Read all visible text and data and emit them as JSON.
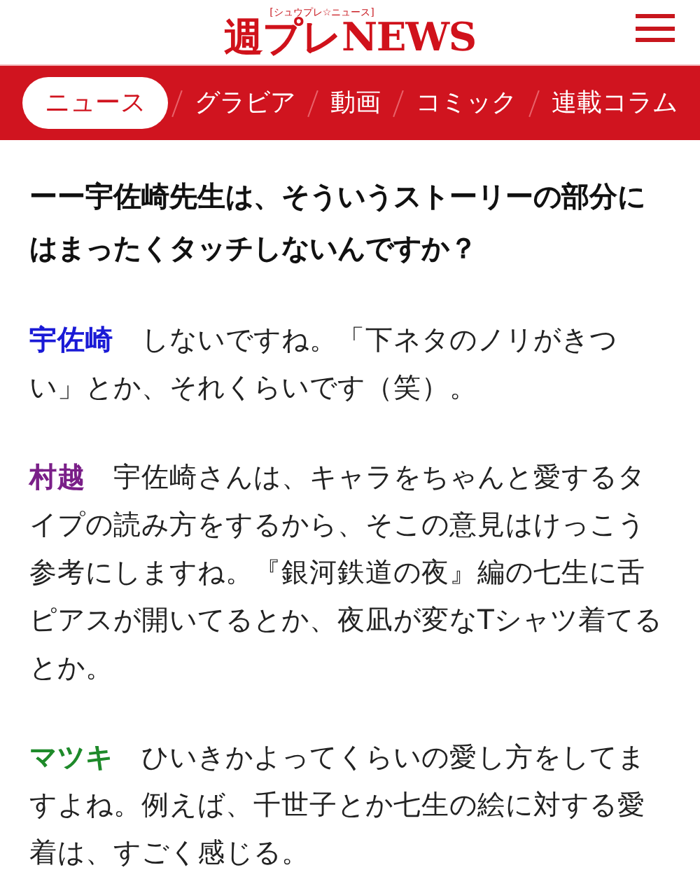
{
  "header": {
    "logo_caption": "[シュウプレ☆ニュース]",
    "logo": "週プレNEWS"
  },
  "nav": [
    {
      "label": "ニュース",
      "selected": true
    },
    {
      "label": "グラビア",
      "selected": false
    },
    {
      "label": "動画",
      "selected": false
    },
    {
      "label": "コミック",
      "selected": false
    },
    {
      "label": "連載コラム",
      "selected": false
    }
  ],
  "question": "ーー宇佐崎先生は、そういうストーリーの部分にはまったくタッチしないんですか？",
  "answers": [
    {
      "speaker": "宇佐崎",
      "color": "#1a1ad6",
      "text": "しないですね。「下ネタのノリがきつい」とか、それくらいです（笑）。"
    },
    {
      "speaker": "村越",
      "color": "#7a1f88",
      "text": "宇佐崎さんは、キャラをちゃんと愛するタイプの読み方をするから、そこの意見はけっこう参考にしますね。『銀河鉄道の夜』編の七生に舌ピアスが開いてるとか、夜凪が変なTシャツ着てるとか。"
    },
    {
      "speaker": "マツキ",
      "color": "#1e8a2a",
      "text": "ひいきかよってくらいの愛し方をしてますよね。例えば、千世子とか七生の絵に対する愛着は、すごく感じる。"
    }
  ]
}
